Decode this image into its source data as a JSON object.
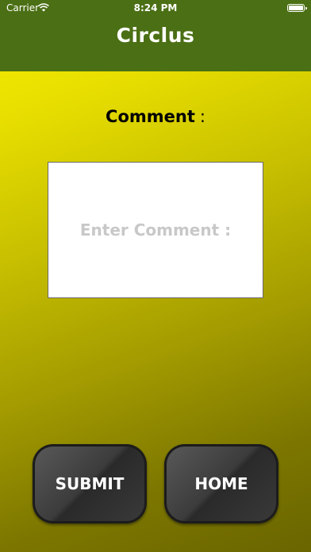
{
  "status_bar": {
    "carrier": "Carrier",
    "time": "8:24 PM"
  },
  "nav": {
    "title": "Circlus"
  },
  "comment": {
    "label": "Comment",
    "colon": ":",
    "placeholder": "Enter Comment :"
  },
  "buttons": {
    "submit": "SUBMIT",
    "home": "HOME"
  },
  "colors": {
    "nav_bg": "#4b6f14",
    "gradient_start": "#f7ef00",
    "gradient_end": "#6a6500",
    "button": "#3c3c3c"
  },
  "icons": {
    "wifi": "wifi-icon",
    "battery": "battery-icon"
  }
}
